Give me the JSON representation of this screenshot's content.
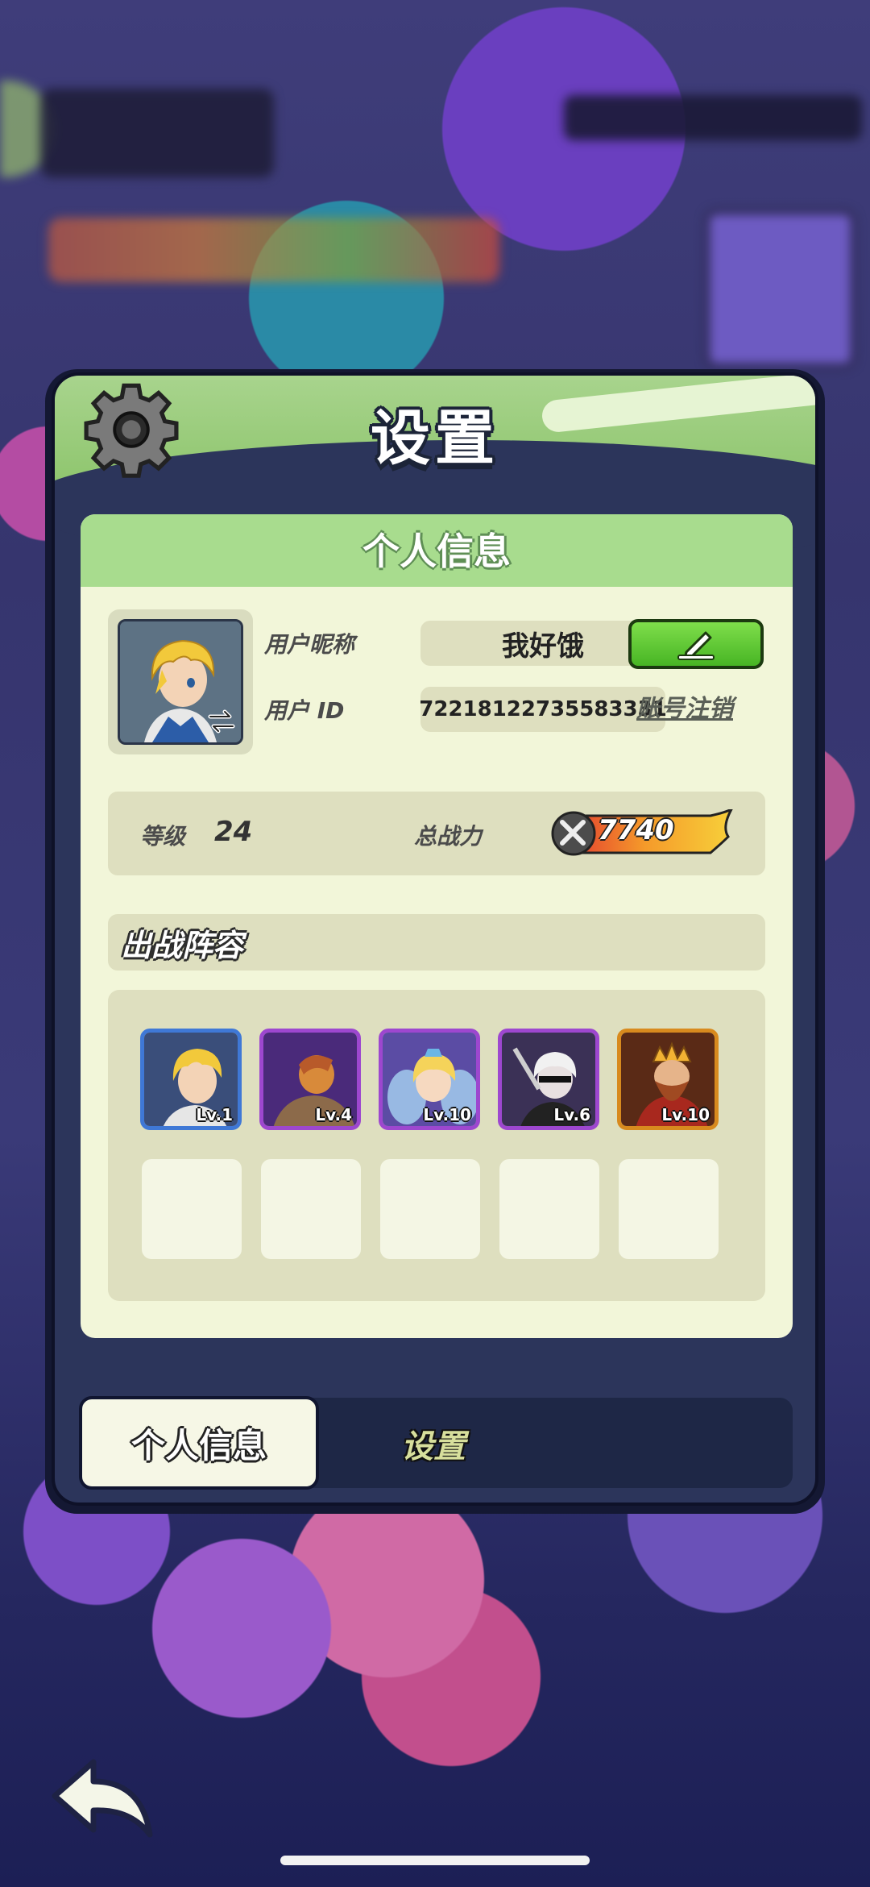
{
  "modal": {
    "title": "设置",
    "panel_title": "个人信息",
    "user": {
      "nickname_label": "用户昵称",
      "nickname": "我好饿",
      "id_label": "用户 ID",
      "id_value": "72218122735583331",
      "cancel_account": "账号注销"
    },
    "stats": {
      "level_label": "等级",
      "level_value": "24",
      "power_label": "总战力",
      "power_value": "7740"
    },
    "lineup": {
      "title": "出战阵容",
      "heroes": [
        {
          "level": "Lv.1",
          "frame_color": "#3f78d6",
          "bg": "#3a4e7a"
        },
        {
          "level": "Lv.4",
          "frame_color": "#9d47cf",
          "bg": "#4a2a7a"
        },
        {
          "level": "Lv.10",
          "frame_color": "#9d47cf",
          "bg": "#5b4ca4"
        },
        {
          "level": "Lv.6",
          "frame_color": "#9d47cf",
          "bg": "#3b3156"
        },
        {
          "level": "Lv.10",
          "frame_color": "#d88a1e",
          "bg": "#5a2a16"
        }
      ],
      "empty_slots": 5
    },
    "tabs": {
      "active": "个人信息",
      "inactive": "设置"
    }
  },
  "colors": {
    "header_green": "#a8d48d",
    "panel_bg": "#f2f6d9",
    "edit_green": "#47b524"
  }
}
